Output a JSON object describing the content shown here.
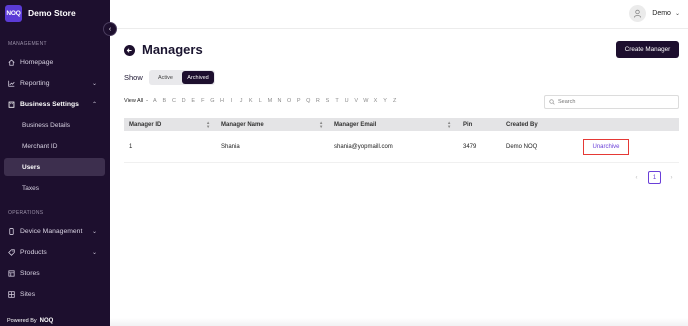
{
  "brand": {
    "logo_text": "NOQ",
    "name": "Demo Store"
  },
  "sidebar": {
    "section_management": "MANAGEMENT",
    "section_operations": "OPERATIONS",
    "items": {
      "homepage": "Homepage",
      "reporting": "Reporting",
      "business_settings": "Business Settings",
      "business_details": "Business Details",
      "merchant_id": "Merchant ID",
      "users": "Users",
      "taxes": "Taxes",
      "device_management": "Device Management",
      "products": "Products",
      "stores": "Stores",
      "sites": "Sites"
    },
    "powered_by": "Powered By",
    "powered_logo": "NOQ"
  },
  "user": {
    "name": "Demo"
  },
  "page": {
    "title": "Managers",
    "create_button": "Create Manager",
    "show_label": "Show",
    "toggle": {
      "active": "Active",
      "archived": "Archived",
      "selected": "Archived"
    },
    "view_all": "View All",
    "view_all_sep": "-",
    "letters": [
      "A",
      "B",
      "C",
      "D",
      "E",
      "F",
      "G",
      "H",
      "I",
      "J",
      "K",
      "L",
      "M",
      "N",
      "O",
      "P",
      "Q",
      "R",
      "S",
      "T",
      "U",
      "V",
      "W",
      "X",
      "Y",
      "Z"
    ],
    "search_placeholder": "Search"
  },
  "table": {
    "headers": {
      "manager_id": "Manager ID",
      "manager_name": "Manager Name",
      "manager_email": "Manager Email",
      "pin": "Pin",
      "created_by": "Created By"
    },
    "rows": [
      {
        "manager_id": "1",
        "manager_name": "Shania",
        "manager_email": "shania@yopmaill.com",
        "pin": "3479",
        "created_by": "Demo NOQ",
        "action": "Unarchive"
      }
    ]
  },
  "pagination": {
    "prev": "‹",
    "current": "1",
    "next": "›"
  },
  "colors": {
    "sidebar_bg": "#1d0f2e",
    "accent": "#6a3fd8",
    "highlight_border": "#e53935",
    "logo_bg": "#5b3bd6"
  }
}
